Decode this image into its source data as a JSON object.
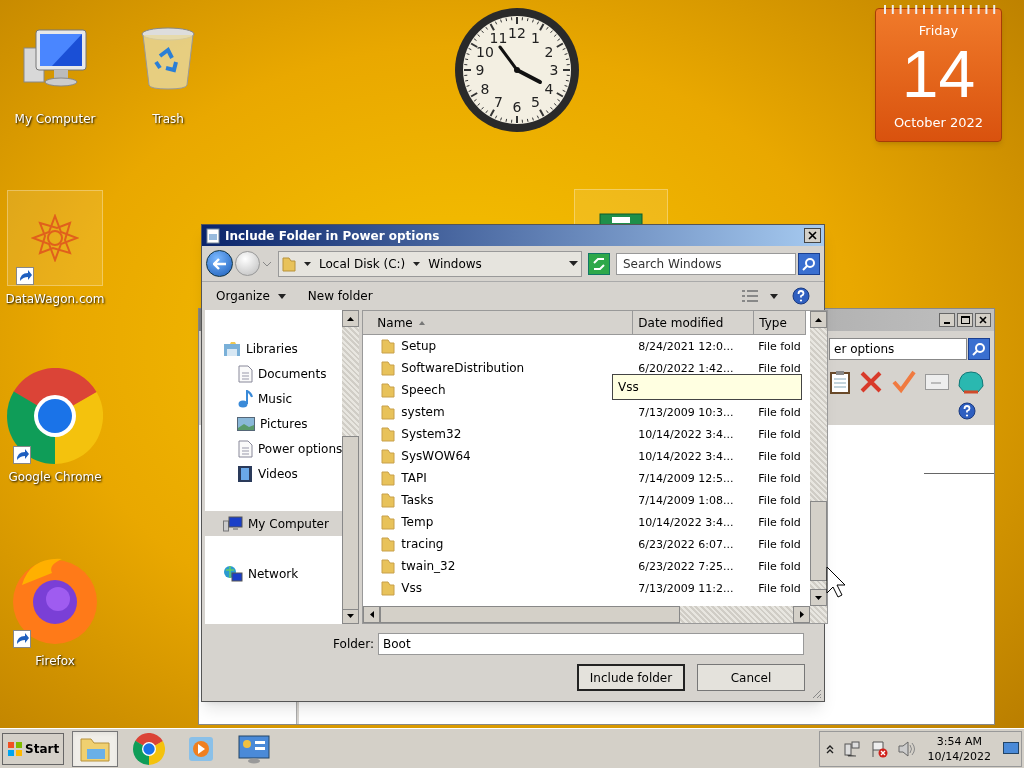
{
  "desktop_icons": [
    {
      "label": "My Computer",
      "kind": "computer",
      "shortcut": false
    },
    {
      "label": "Trash",
      "kind": "trash",
      "shortcut": false
    },
    {
      "label": "DataWagon.com",
      "kind": "star",
      "shortcut": true
    },
    {
      "label": "Google Chrome",
      "kind": "chrome",
      "shortcut": true
    },
    {
      "label": "Firefox",
      "kind": "firefox",
      "shortcut": true
    }
  ],
  "clock_gadget": {
    "numerals": [
      "12",
      "11",
      "1",
      "10",
      "2",
      "9",
      "3",
      "8",
      "4",
      "7",
      "5",
      "6"
    ]
  },
  "calendar_gadget": {
    "weekday": "Friday",
    "day": "14",
    "month_year": "October 2022"
  },
  "background_window": {
    "search_value": "er options"
  },
  "dialog": {
    "title": "Include Folder in Power options",
    "breadcrumb": [
      "Local Disk (C:)",
      "Windows"
    ],
    "search_placeholder": "Search Windows",
    "toolbar": [
      "Organize",
      "New folder"
    ],
    "nav": [
      {
        "label": "Libraries",
        "kind": "library",
        "selected": false,
        "children": [
          {
            "label": "Documents",
            "kind": "documents",
            "selected": false
          },
          {
            "label": "Music",
            "kind": "music",
            "selected": false
          },
          {
            "label": "Pictures",
            "kind": "pictures",
            "selected": false
          },
          {
            "label": "Power options",
            "kind": "documents",
            "selected": false
          },
          {
            "label": "Videos",
            "kind": "videos",
            "selected": false
          }
        ]
      },
      {
        "label": "My Computer",
        "kind": "computer",
        "selected": true
      },
      {
        "label": "Network",
        "kind": "network",
        "selected": false
      }
    ],
    "columns": [
      {
        "label": "Name",
        "sorted": true
      },
      {
        "label": "Date modified",
        "sorted": false
      },
      {
        "label": "Type",
        "sorted": false
      }
    ],
    "rows": [
      {
        "name": "Setup",
        "date": "8/24/2021 12:0...",
        "type": "File fold"
      },
      {
        "name": "SoftwareDistribution",
        "date": "6/20/2022 1:42...",
        "type": "File fold"
      },
      {
        "name": "Speech"
      },
      {
        "name": "system",
        "date": "7/13/2009 10:3...",
        "type": "File fold"
      },
      {
        "name": "System32",
        "date": "10/14/2022 3:4...",
        "type": "File fold"
      },
      {
        "name": "SysWOW64",
        "date": "10/14/2022 3:4...",
        "type": "File fold"
      },
      {
        "name": "TAPI",
        "date": "7/14/2009 12:5...",
        "type": "File fold"
      },
      {
        "name": "Tasks",
        "date": "7/14/2009 1:08...",
        "type": "File fold"
      },
      {
        "name": "Temp",
        "date": "10/14/2022 3:4...",
        "type": "File fold"
      },
      {
        "name": "tracing",
        "date": "6/23/2022 6:07...",
        "type": "File fold"
      },
      {
        "name": "twain_32",
        "date": "6/23/2022 7:25...",
        "type": "File fold"
      },
      {
        "name": "Vss",
        "date": "7/13/2009 11:2...",
        "type": "File fold"
      }
    ],
    "tooltip": "Vss",
    "folder_label": "Folder:",
    "folder_value": "Boot",
    "buttons": [
      {
        "label": "Include folder",
        "default": true
      },
      {
        "label": "Cancel",
        "default": false
      }
    ]
  },
  "taskbar": {
    "start": "Start",
    "apps": [
      {
        "kind": "explorer",
        "selected": true
      },
      {
        "kind": "chrome",
        "selected": false
      },
      {
        "kind": "media",
        "selected": false
      },
      {
        "kind": "control",
        "selected": false
      }
    ],
    "time": "3:54 AM",
    "date": "10/14/2022"
  }
}
